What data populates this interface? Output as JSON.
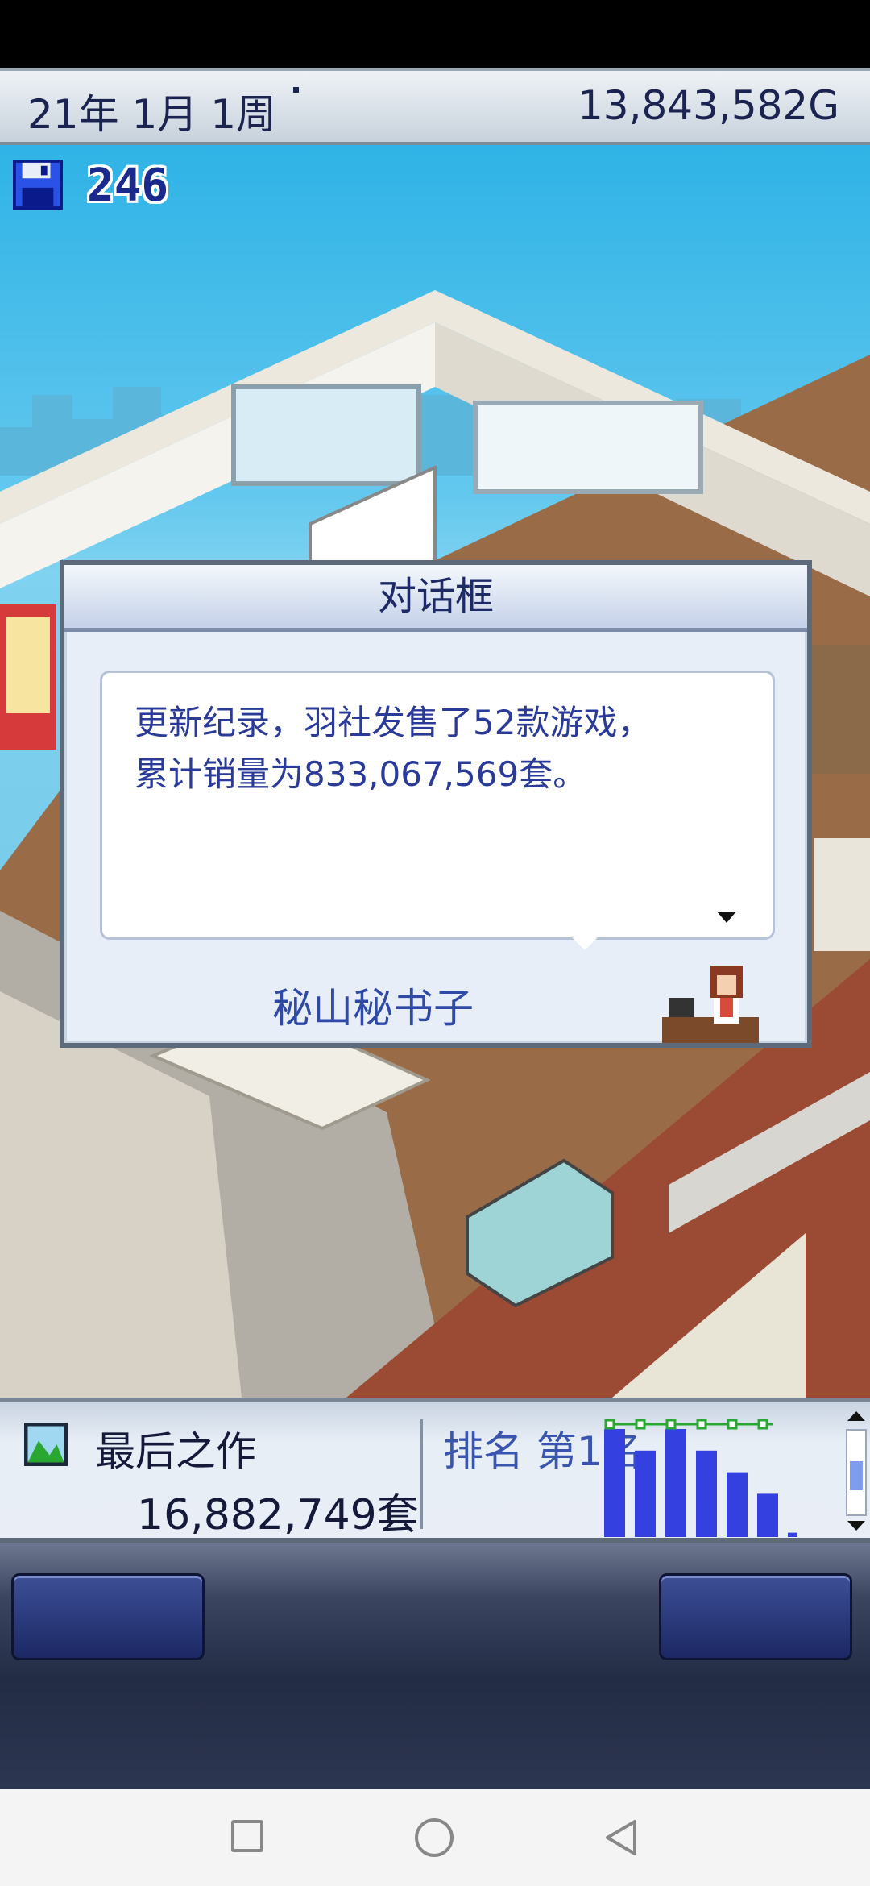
{
  "top_bar": {
    "date": "21年 1月 1周",
    "money": "13,843,582G"
  },
  "hud": {
    "disk_count": "246",
    "disk_icon": "floppy-disk-icon"
  },
  "dialog": {
    "title": "对话框",
    "message_line1": "更新纪录，羽社发售了52款游戏，",
    "message_line2": "累计销量为833,067,569套。",
    "speaker": "秘山秘书子"
  },
  "info_panel": {
    "last_work_label": "最后之作",
    "last_work_sales": "16,882,749套",
    "rank_label": "排名 第1名",
    "rank_chart": {
      "type": "bar",
      "values": [
        5,
        4,
        5,
        4,
        3,
        2,
        0.2
      ],
      "colors": {
        "bar": "#3440e0",
        "marker": "#2aa632"
      }
    }
  },
  "colors": {
    "top_text": "#1b2350",
    "dialog_text": "#2a3a98",
    "speaker_text": "#2f4aa6"
  }
}
